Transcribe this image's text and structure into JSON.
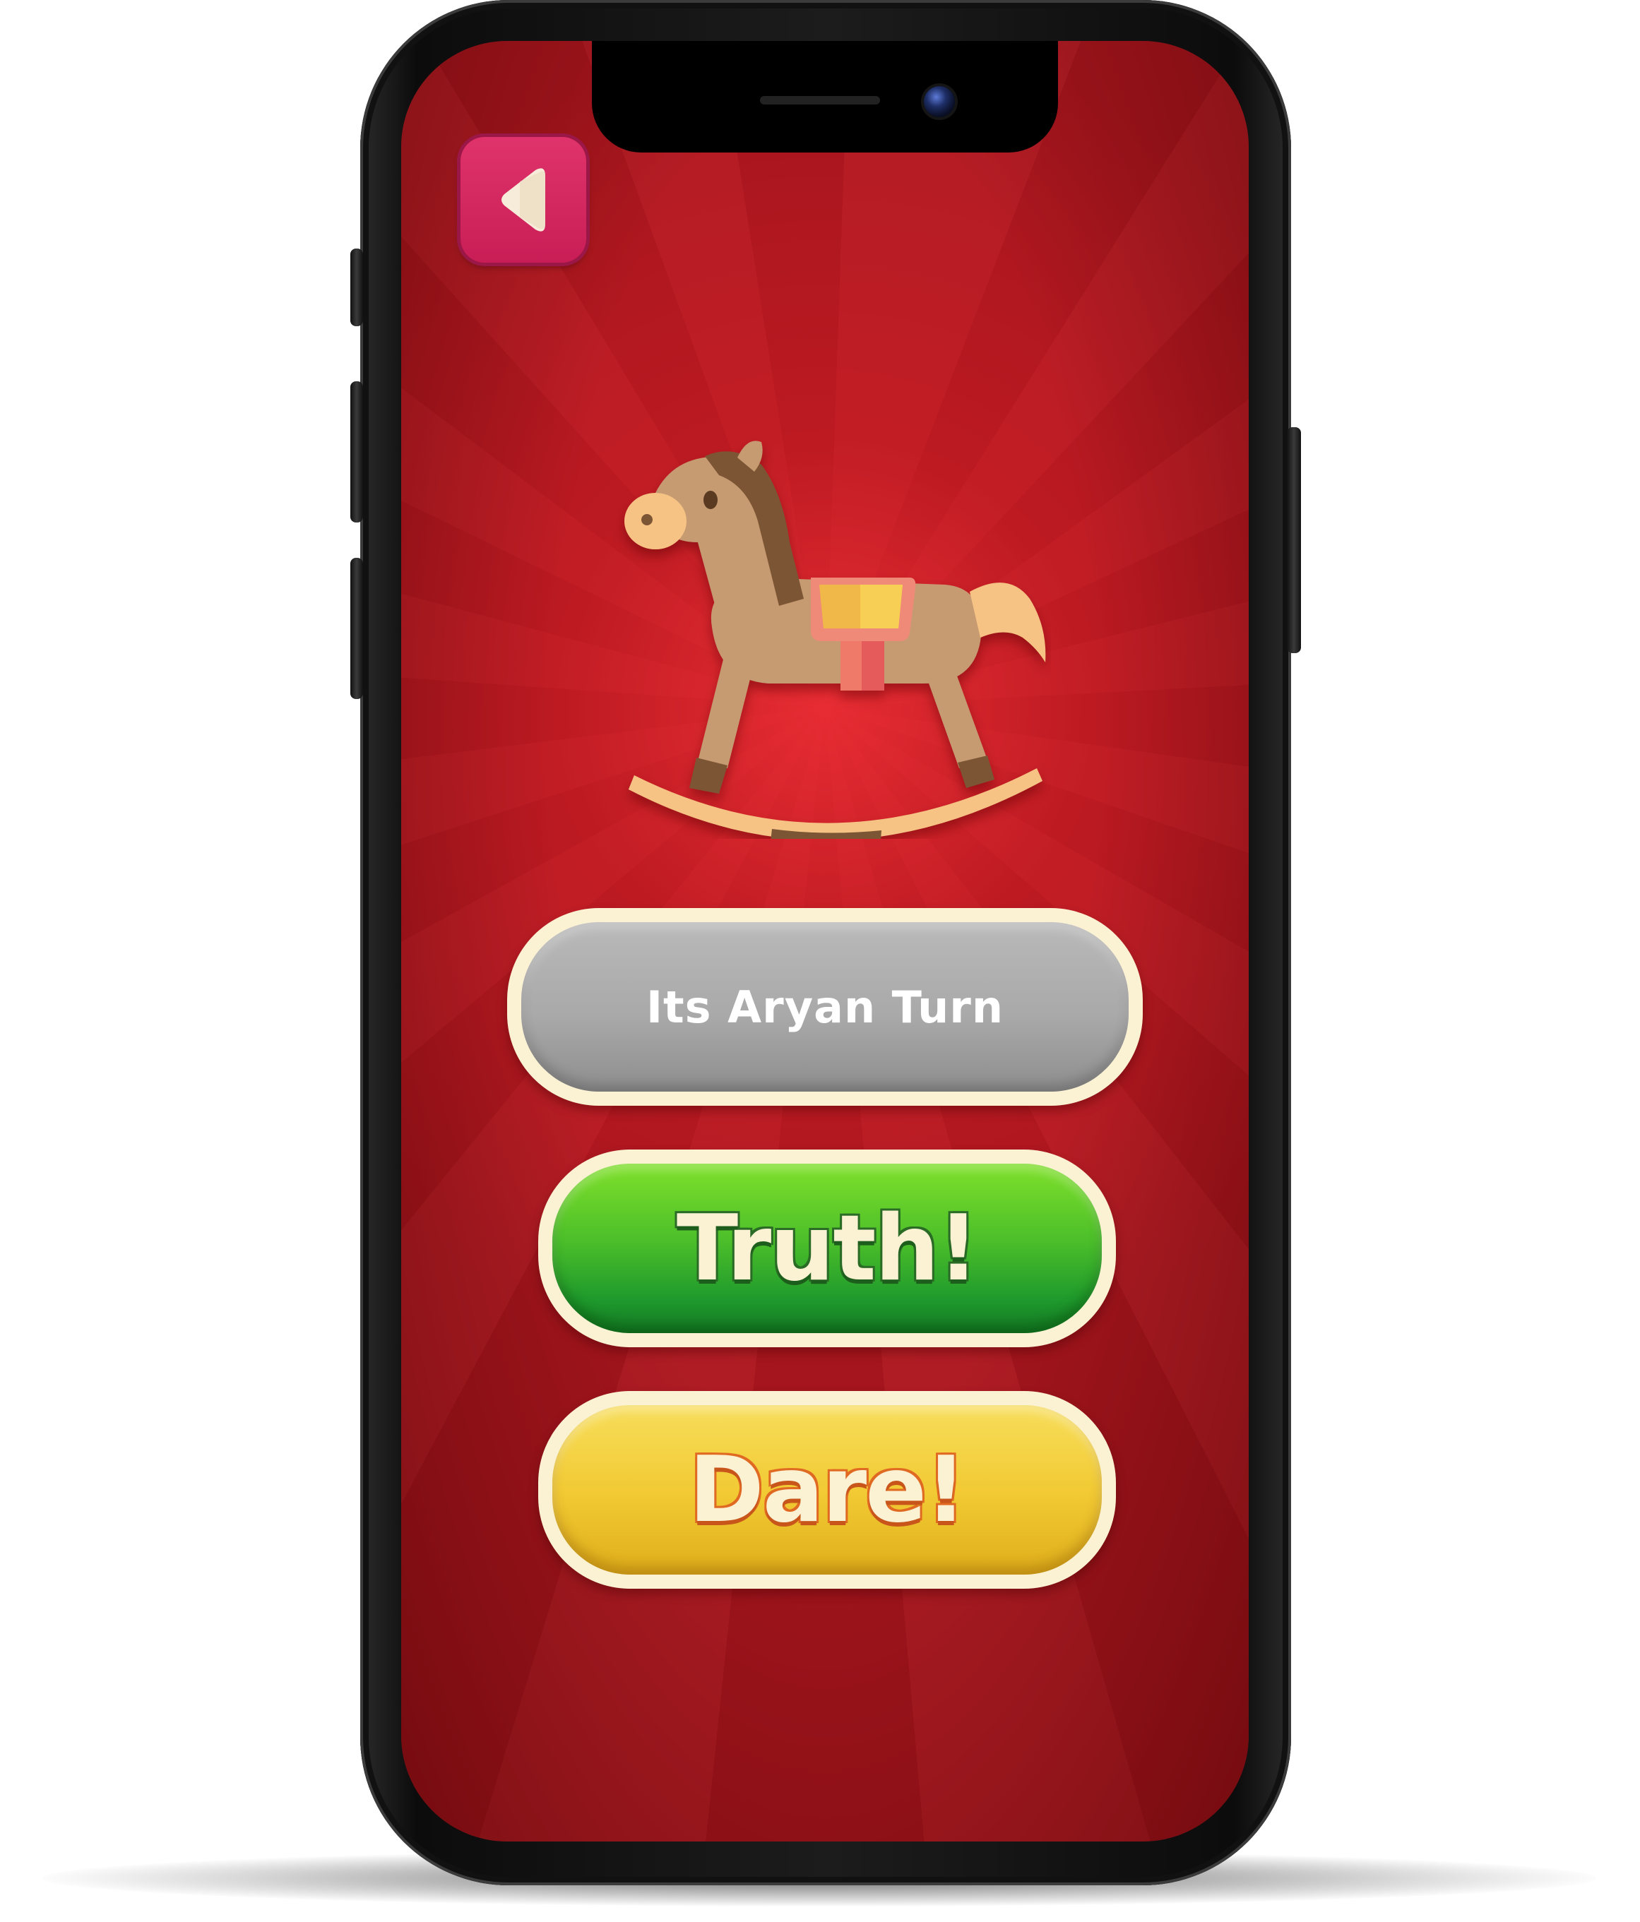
{
  "game": {
    "turn_text": "Its Aryan Turn",
    "truth_label": "Truth!",
    "dare_label": "Dare!"
  },
  "icons": {
    "back": "back-arrow-icon",
    "mascot": "rocking-horse-icon"
  },
  "colors": {
    "background": "#b01c24",
    "back_button": "#d8285f",
    "turn_pill": "#a9a9a9",
    "truth_button": "#4cbf2a",
    "dare_button": "#f2cb35",
    "pill_border": "#fbf1d3"
  }
}
